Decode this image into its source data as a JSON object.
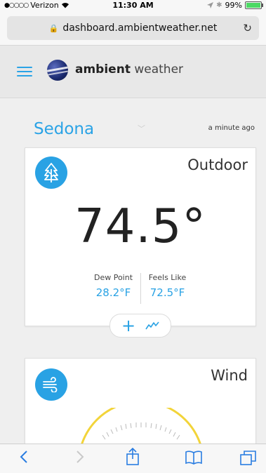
{
  "status_bar": {
    "carrier": "Verizon",
    "time": "11:30 AM",
    "battery": "99%",
    "battery_level": 0.99
  },
  "browser": {
    "url": "dashboard.ambientweather.net"
  },
  "app": {
    "brand_bold": "ambient",
    "brand_light": "weather",
    "accent_color": "#29a2e4"
  },
  "location": {
    "name": "Sedona",
    "updated": "a minute ago"
  },
  "outdoor_card": {
    "icon": "tree-icon",
    "title": "Outdoor",
    "temperature": "74.5°",
    "dew_point_label": "Dew Point",
    "dew_point_value": "28.2°F",
    "feels_like_label": "Feels Like",
    "feels_like_value": "72.5°F"
  },
  "wind_card": {
    "icon": "wind-icon",
    "title": "Wind"
  }
}
